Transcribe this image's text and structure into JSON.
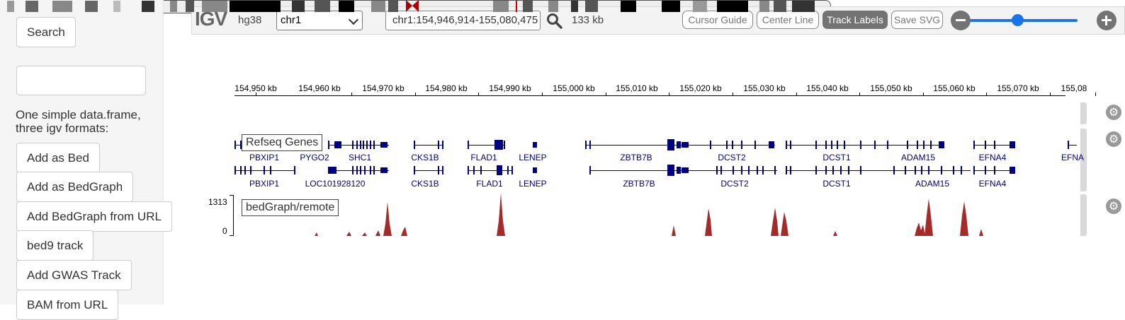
{
  "sidebar": {
    "search_button": "Search",
    "text_input_value": "",
    "description": "One simple data.frame, three igv formats:",
    "buttons": [
      "Add as Bed",
      "Add as BedGraph",
      "Add BedGraph from URL",
      "bed9 track",
      "Add GWAS Track",
      "BAM from URL"
    ]
  },
  "igv": {
    "logo": "IGV",
    "genome": "hg38",
    "chromosome": "chr1",
    "locus": "chr1:154,946,914-155,080,475",
    "width_label": "133 kb",
    "toggles": [
      {
        "label": "Cursor Guide",
        "active": false
      },
      {
        "label": "Center Line",
        "active": false
      },
      {
        "label": "Track Labels",
        "active": true
      },
      {
        "label": "Save SVG",
        "active": false
      }
    ],
    "zoom_level": 0.45,
    "ruler_labels": [
      "154,950 kb",
      "154,960 kb",
      "154,970 kb",
      "154,980 kb",
      "154,990 kb",
      "155,000 kb",
      "155,010 kb",
      "155,020 kb",
      "155,030 kb",
      "155,040 kb",
      "155,050 kb",
      "155,060 kb",
      "155,070 kb",
      "155,08"
    ]
  },
  "tracks": {
    "refseq": {
      "label": "Refseq Genes",
      "row1_names": [
        "PBXIP1",
        "PYGO2",
        "SHC1",
        "CKS1B",
        "FLAD1",
        "LENEP",
        "ZBTB7B",
        "DCST2",
        "DCST1",
        "ADAM15",
        "EFNA4",
        "EFNA"
      ],
      "row2_names": [
        "PBXIP1",
        "LOC101928120",
        "CKS1B",
        "FLAD1",
        "LENEP",
        "ZBTB7B",
        "DCST2",
        "DCST1",
        "ADAM15",
        "EFNA4"
      ]
    },
    "bedgraph": {
      "label": "bedGraph/remote",
      "scale_max": "1313",
      "scale_min": "0",
      "color": "#a52a2a"
    }
  },
  "colors": {
    "gene": "#000080",
    "bedgraph": "#a52a2a",
    "accent": "#1a73e8"
  }
}
